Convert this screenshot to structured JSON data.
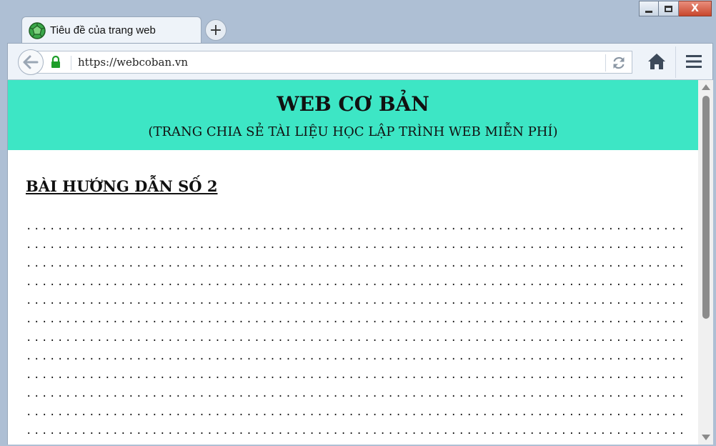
{
  "browser": {
    "tab": {
      "title": "Tiêu đề của trang web",
      "favicon": "globe-icon"
    },
    "new_tab_label": "+",
    "url": "https://webcoban.vn",
    "window_controls": {
      "minimize": "minimize-icon",
      "maximize": "maximize-icon",
      "close": "X"
    }
  },
  "page": {
    "site_title": "WEB CƠ BẢN",
    "site_subtitle": "(TRANG CHIA SẺ TÀI LIỆU HỌC LẬP TRÌNH WEB MIỄN PHÍ)",
    "lesson_heading": "BÀI HƯỚNG DẪN SỐ 2",
    "dot_lines": [
      ".....................................................................................................",
      ".....................................................................................................",
      ".....................................................................................................",
      ".....................................................................................................",
      ".....................................................................................................",
      ".....................................................................................................",
      ".....................................................................................................",
      ".....................................................................................................",
      ".....................................................................................................",
      ".....................................................................................................",
      ".....................................................................................................",
      "....................................................................................................."
    ]
  },
  "colors": {
    "header_bg": "#3de6c5",
    "chrome_bg": "#eef3f9",
    "close_button": "#c8472d",
    "lock_green": "#1e9e2a"
  }
}
